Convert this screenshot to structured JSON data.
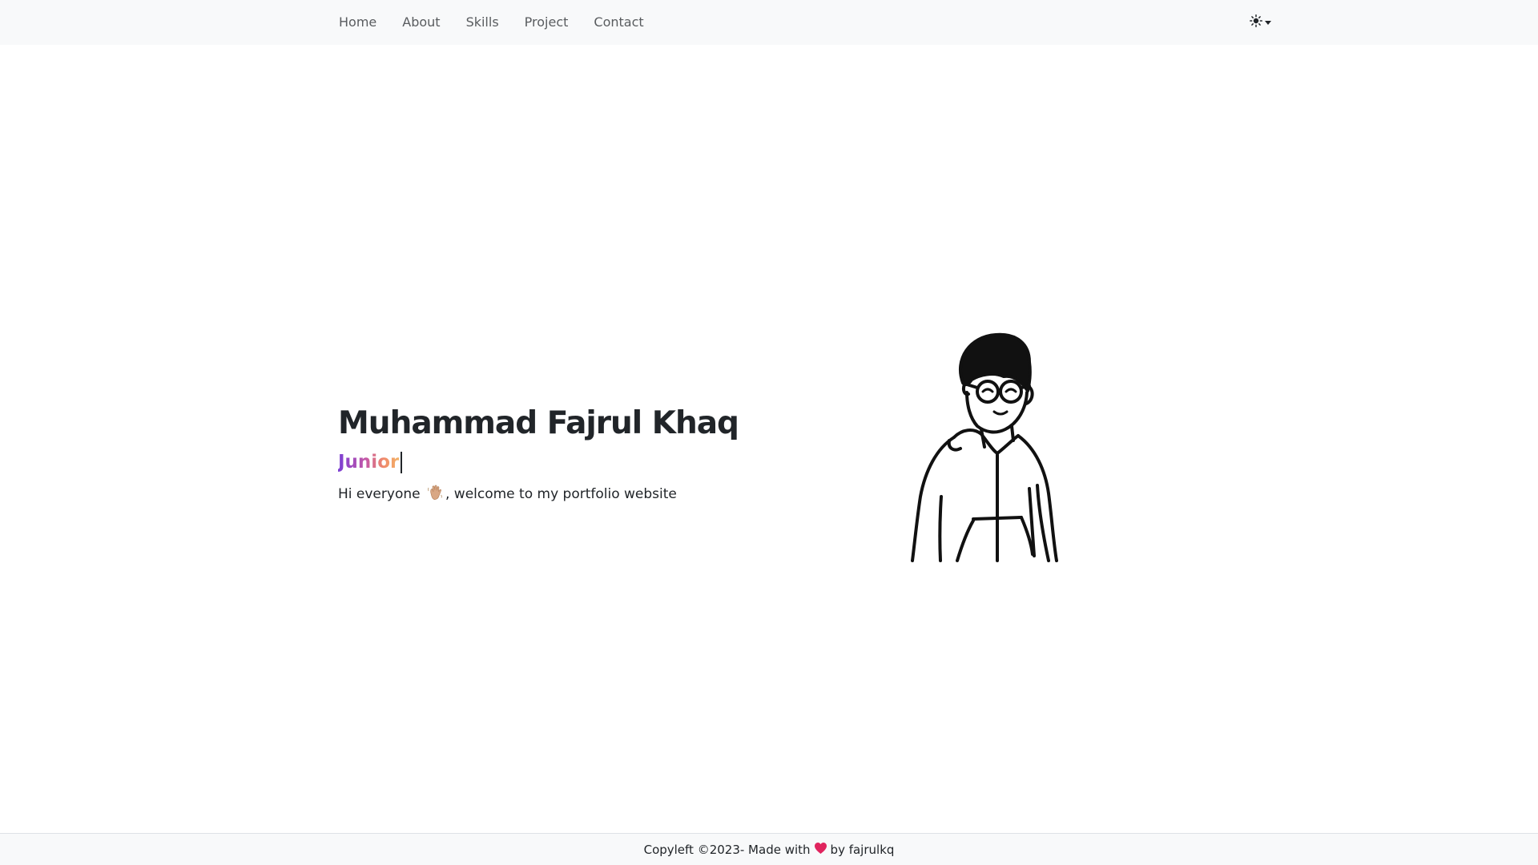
{
  "nav": {
    "items": [
      {
        "label": "Home"
      },
      {
        "label": "About"
      },
      {
        "label": "Skills"
      },
      {
        "label": "Project"
      },
      {
        "label": "Contact"
      }
    ],
    "theme_icon": "sun-icon"
  },
  "hero": {
    "name": "Muhammad Fajrul Khaq",
    "role": "Junior",
    "greeting_before": "Hi everyone",
    "greeting_after": ", welcome to my portfolio website",
    "wave_icon": "waving-hand-icon",
    "illustration": "avatar-illustration"
  },
  "footer": {
    "text_before": "Copyleft ©2023- Made with",
    "text_after": "by fajrulkq",
    "heart_icon": "heart-icon",
    "heart_color": "#e0245e"
  },
  "colors": {
    "navbar_bg": "#f8f9fa",
    "role_gradient": [
      "#7b3fd4",
      "#c357a8",
      "#f08a6a",
      "#f3b266"
    ]
  }
}
